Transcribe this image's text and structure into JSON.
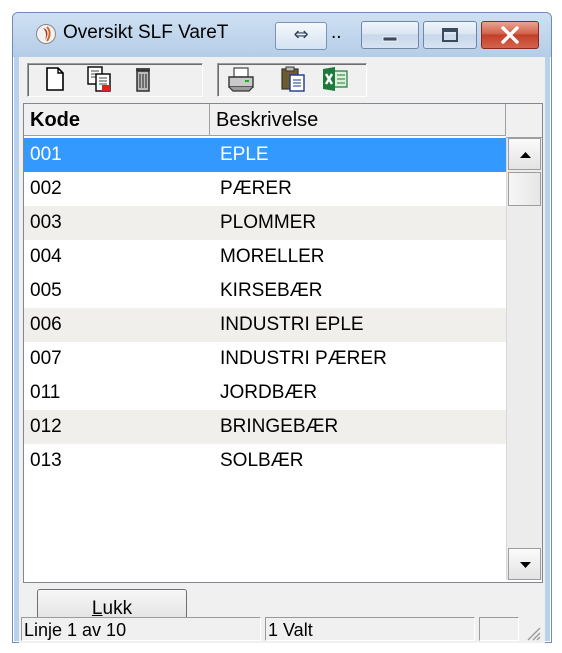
{
  "window": {
    "title": "Oversikt SLF VareT",
    "title_overflow": "..",
    "app_icon": "app-icon",
    "buttons": [
      "minimize",
      "maximize",
      "close"
    ]
  },
  "toolbar": {
    "buttons": [
      "new-document-icon",
      "copy-record-icon",
      "delete-icon",
      "print-icon",
      "paste-icon",
      "excel-export-icon"
    ]
  },
  "grid": {
    "columns": [
      "Kode",
      "Beskrivelse"
    ],
    "rows": [
      {
        "kode": "001",
        "beskrivelse": "EPLE"
      },
      {
        "kode": "002",
        "beskrivelse": "PÆRER"
      },
      {
        "kode": "003",
        "beskrivelse": "PLOMMER"
      },
      {
        "kode": "004",
        "beskrivelse": "MORELLER"
      },
      {
        "kode": "005",
        "beskrivelse": "KIRSEBÆR"
      },
      {
        "kode": "006",
        "beskrivelse": "INDUSTRI EPLE"
      },
      {
        "kode": "007",
        "beskrivelse": "INDUSTRI PÆRER"
      },
      {
        "kode": "011",
        "beskrivelse": "JORDBÆR"
      },
      {
        "kode": "012",
        "beskrivelse": "BRINGEBÆR"
      },
      {
        "kode": "013",
        "beskrivelse": "SOLBÆR"
      }
    ],
    "selected_index": 0
  },
  "close_button": {
    "label_mnemonic": "L",
    "label_rest": "ukk"
  },
  "status": {
    "line": "Linje 1 av 10",
    "selected": "1 Valt",
    "extra": ""
  },
  "colors": {
    "selection": "#3399ff",
    "alt_row": "#f1efec",
    "close_red": "#c2402a"
  }
}
